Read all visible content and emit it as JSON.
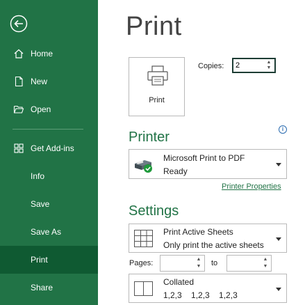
{
  "sidebar": {
    "items": [
      {
        "label": "Home",
        "icon": "home-icon"
      },
      {
        "label": "New",
        "icon": "new-document-icon"
      },
      {
        "label": "Open",
        "icon": "open-folder-icon"
      },
      {
        "label": "Get Add-ins",
        "icon": "add-ins-icon"
      },
      {
        "label": "Info"
      },
      {
        "label": "Save"
      },
      {
        "label": "Save As"
      },
      {
        "label": "Print",
        "active": true
      },
      {
        "label": "Share"
      }
    ]
  },
  "main": {
    "title": "Print",
    "print_button_label": "Print",
    "copies_label": "Copies:",
    "copies_value": "2",
    "printer_heading": "Printer",
    "printer_name": "Microsoft Print to PDF",
    "printer_status": "Ready",
    "printer_properties_link": "Printer Properties",
    "settings_heading": "Settings",
    "print_what_title": "Print Active Sheets",
    "print_what_desc": "Only print the active sheets",
    "pages_label": "Pages:",
    "to_label": "to",
    "pages_from": "",
    "pages_to": "",
    "collation_title": "Collated",
    "collation_desc": "1,2,3    1,2,3    1,2,3"
  },
  "colors": {
    "sidebar_bg": "#217346",
    "sidebar_active": "#0f5a32",
    "accent": "#217346"
  }
}
